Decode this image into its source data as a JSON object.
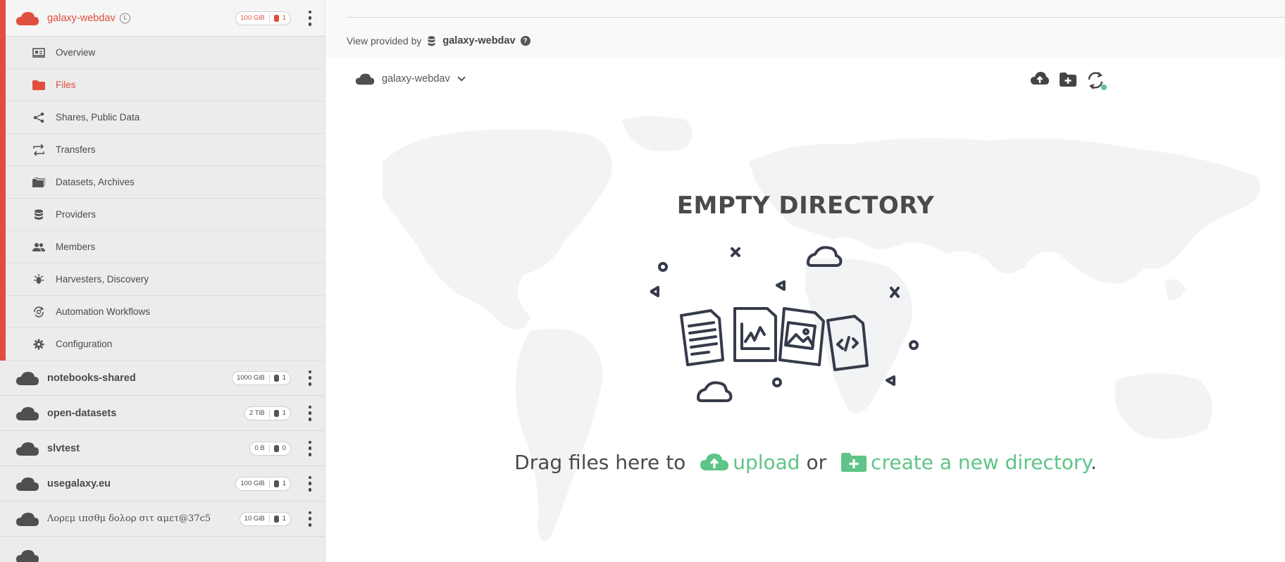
{
  "sidebar": {
    "active_space": {
      "name": "galaxy-webdav",
      "size": "100 GiB",
      "providers": "1",
      "menu": [
        {
          "label": "Overview",
          "icon": "overview-icon"
        },
        {
          "label": "Files",
          "icon": "folder-icon",
          "active": true
        },
        {
          "label": "Shares, Public Data",
          "icon": "share-icon"
        },
        {
          "label": "Transfers",
          "icon": "transfers-icon"
        },
        {
          "label": "Datasets, Archives",
          "icon": "datasets-icon"
        },
        {
          "label": "Providers",
          "icon": "database-icon"
        },
        {
          "label": "Members",
          "icon": "members-icon"
        },
        {
          "label": "Harvesters, Discovery",
          "icon": "harvester-icon"
        },
        {
          "label": "Automation Workflows",
          "icon": "automation-icon"
        },
        {
          "label": "Configuration",
          "icon": "gear-icon"
        }
      ]
    },
    "spaces": [
      {
        "name": "notebooks-shared",
        "size": "1000 GiB",
        "providers": "1"
      },
      {
        "name": "open-datasets",
        "size": "2 TiB",
        "providers": "1"
      },
      {
        "name": "slvtest",
        "size": "0 B",
        "providers": "0"
      },
      {
        "name": "usegalaxy.eu",
        "size": "100 GiB",
        "providers": "1"
      },
      {
        "name": "Λορεμ ιπσθμ δολορ σιτ αμετ@37c5",
        "size": "10 GiB",
        "providers": "1"
      }
    ]
  },
  "main": {
    "view_provided_by": "View provided by",
    "provider_name": "galaxy-webdav",
    "help": "?",
    "breadcrumb": "galaxy-webdav",
    "empty_title": "EMPTY DIRECTORY",
    "drag_prefix": "Drag files here to",
    "upload_label": "upload",
    "or_label": "or",
    "create_dir_label": "create a new directory",
    "suffix": "."
  },
  "colors": {
    "accent": "#e04e3f",
    "action_green": "#5fc488",
    "text": "#4a4a4a"
  }
}
